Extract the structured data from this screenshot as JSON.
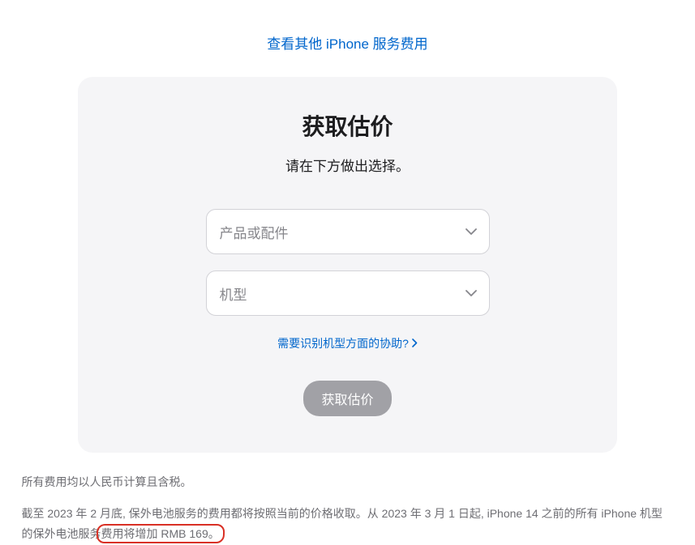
{
  "topLink": {
    "label": "查看其他 iPhone 服务费用"
  },
  "card": {
    "title": "获取估价",
    "subtitle": "请在下方做出选择。",
    "dropdown1": {
      "placeholder": "产品或配件"
    },
    "dropdown2": {
      "placeholder": "机型"
    },
    "helpLink": "需要识别机型方面的协助?",
    "submitLabel": "获取估价"
  },
  "footer": {
    "line1": "所有费用均以人民币计算且含税。",
    "line2_pre": "截至 2023 年 2 月底, 保外电池服务的费用都将按照当前的价格收取。从 2023 年 3 月 1 日起, iPhone 14 之前的所有 iPhone 机型的保外电池服务",
    "line2_highlight": "费用将增加 RMB 169。"
  }
}
